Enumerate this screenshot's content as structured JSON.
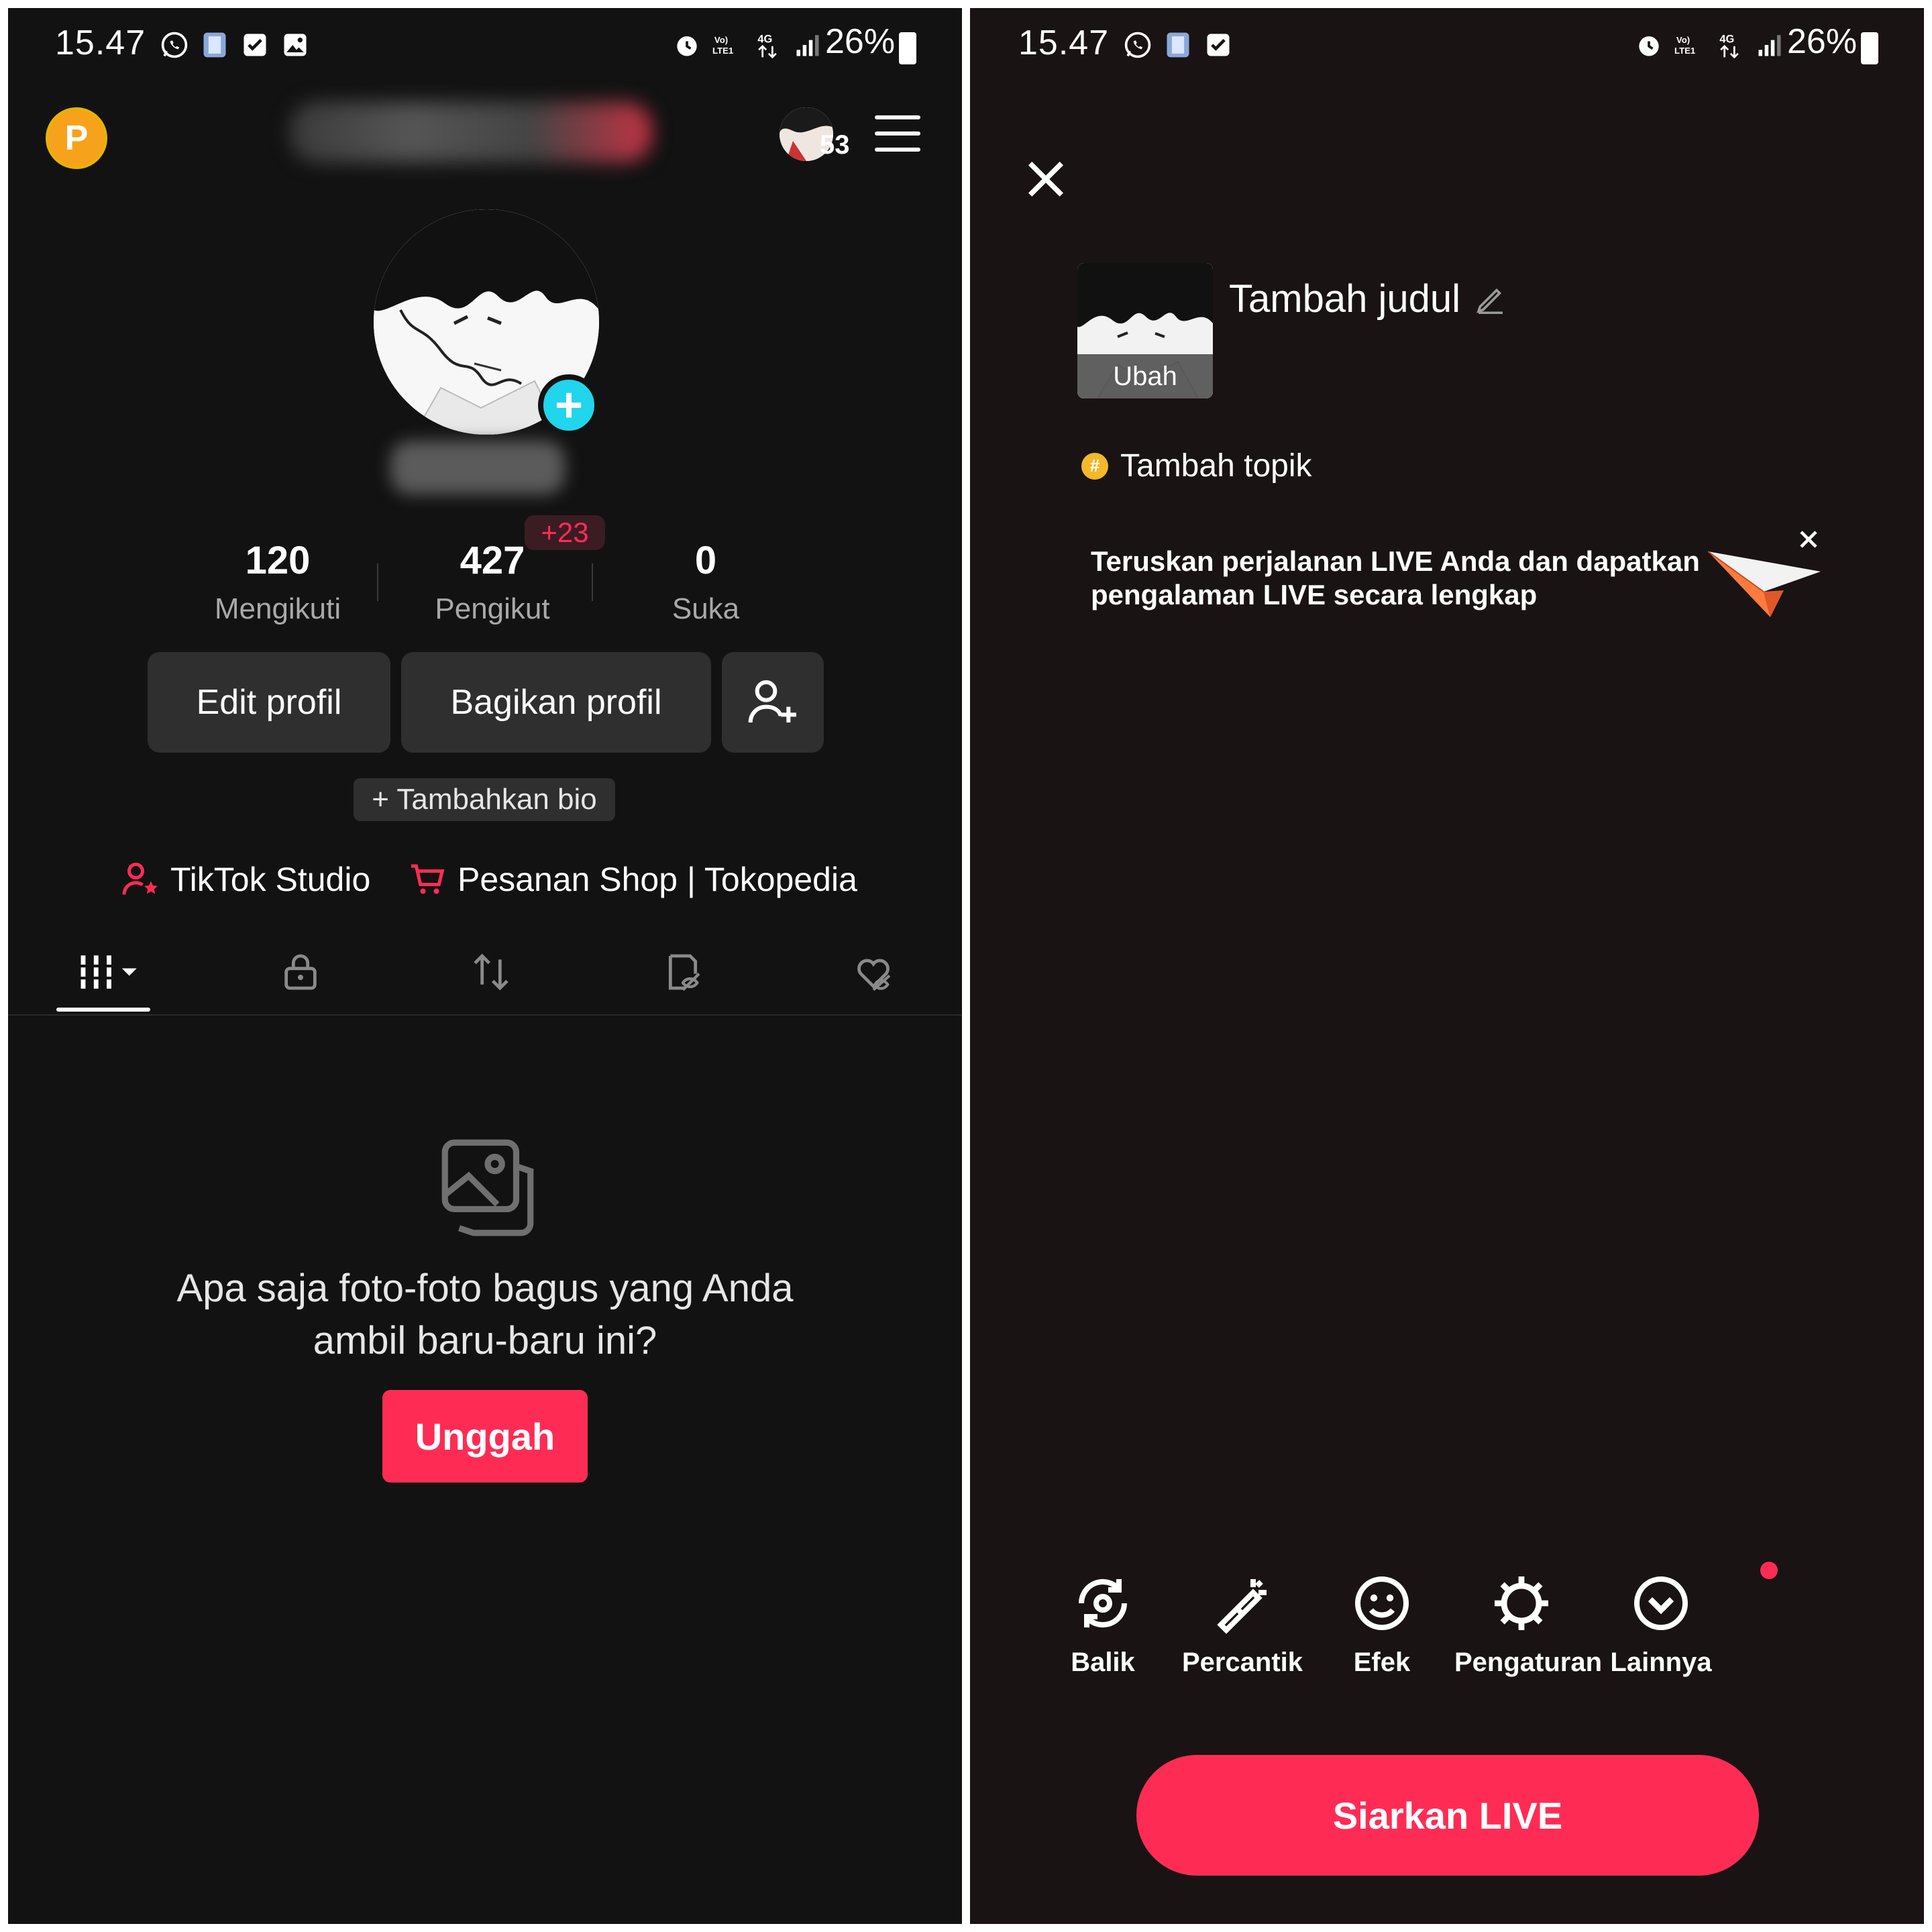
{
  "colors": {
    "accent": "#fe2c55",
    "cyan": "#20d5ec",
    "coin": "#f7a21b",
    "bg_left": "#121212",
    "bg_right": "#1a1313"
  },
  "status_bar": {
    "time": "15.47",
    "battery": "26%",
    "network": "4G"
  },
  "profile": {
    "coin_badge": "P",
    "notif_count": "53",
    "stats": [
      {
        "value": "120",
        "label": "Mengikuti"
      },
      {
        "value": "427",
        "label": "Pengikut"
      },
      {
        "value": "0",
        "label": "Suka"
      }
    ],
    "follower_delta": "+23",
    "edit_btn": "Edit profil",
    "share_btn": "Bagikan profil",
    "add_bio": "+ Tambahkan bio",
    "links": [
      {
        "label": "TikTok Studio",
        "icon": "user-star-icon"
      },
      {
        "label": "Pesanan Shop | Tokopedia",
        "icon": "cart-icon"
      }
    ],
    "tabs": [
      "grid-icon",
      "lock-icon",
      "repost-icon",
      "eye-off-icon",
      "heart-off-icon"
    ],
    "empty_text": "Apa saja foto-foto bagus yang Anda ambil baru-baru ini?",
    "upload_btn": "Unggah"
  },
  "live_setup": {
    "cover_label": "Ubah",
    "title_placeholder": "Tambah judul",
    "topic": "Tambah topik",
    "promo_text": "Teruskan perjalanan LIVE Anda dan dapatkan pengalaman LIVE secara lengkap",
    "tools": [
      {
        "label": "Balik",
        "icon": "flip-camera-icon"
      },
      {
        "label": "Percantik",
        "icon": "magic-wand-icon"
      },
      {
        "label": "Efek",
        "icon": "smiley-icon"
      },
      {
        "label": "Pengaturan",
        "icon": "gear-icon"
      },
      {
        "label": "Lainnya",
        "icon": "chevron-circle-icon"
      }
    ],
    "go_live_btn": "Siarkan LIVE"
  }
}
